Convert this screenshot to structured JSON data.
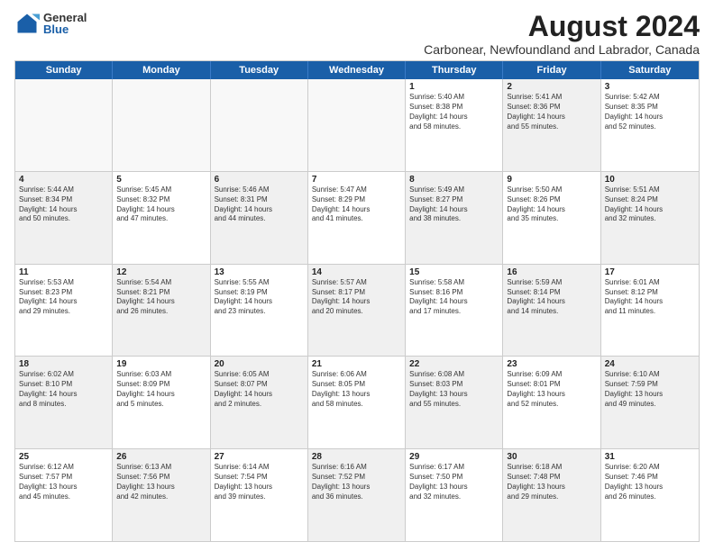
{
  "logo": {
    "general": "General",
    "blue": "Blue"
  },
  "title": "August 2024",
  "subtitle": "Carbonear, Newfoundland and Labrador, Canada",
  "dayHeaders": [
    "Sunday",
    "Monday",
    "Tuesday",
    "Wednesday",
    "Thursday",
    "Friday",
    "Saturday"
  ],
  "rows": [
    [
      {
        "day": "",
        "info": "",
        "empty": true
      },
      {
        "day": "",
        "info": "",
        "empty": true
      },
      {
        "day": "",
        "info": "",
        "empty": true
      },
      {
        "day": "",
        "info": "",
        "empty": true
      },
      {
        "day": "1",
        "info": "Sunrise: 5:40 AM\nSunset: 8:38 PM\nDaylight: 14 hours\nand 58 minutes.",
        "shaded": false
      },
      {
        "day": "2",
        "info": "Sunrise: 5:41 AM\nSunset: 8:36 PM\nDaylight: 14 hours\nand 55 minutes.",
        "shaded": true
      },
      {
        "day": "3",
        "info": "Sunrise: 5:42 AM\nSunset: 8:35 PM\nDaylight: 14 hours\nand 52 minutes.",
        "shaded": false
      }
    ],
    [
      {
        "day": "4",
        "info": "Sunrise: 5:44 AM\nSunset: 8:34 PM\nDaylight: 14 hours\nand 50 minutes.",
        "shaded": true
      },
      {
        "day": "5",
        "info": "Sunrise: 5:45 AM\nSunset: 8:32 PM\nDaylight: 14 hours\nand 47 minutes.",
        "shaded": false
      },
      {
        "day": "6",
        "info": "Sunrise: 5:46 AM\nSunset: 8:31 PM\nDaylight: 14 hours\nand 44 minutes.",
        "shaded": true
      },
      {
        "day": "7",
        "info": "Sunrise: 5:47 AM\nSunset: 8:29 PM\nDaylight: 14 hours\nand 41 minutes.",
        "shaded": false
      },
      {
        "day": "8",
        "info": "Sunrise: 5:49 AM\nSunset: 8:27 PM\nDaylight: 14 hours\nand 38 minutes.",
        "shaded": true
      },
      {
        "day": "9",
        "info": "Sunrise: 5:50 AM\nSunset: 8:26 PM\nDaylight: 14 hours\nand 35 minutes.",
        "shaded": false
      },
      {
        "day": "10",
        "info": "Sunrise: 5:51 AM\nSunset: 8:24 PM\nDaylight: 14 hours\nand 32 minutes.",
        "shaded": true
      }
    ],
    [
      {
        "day": "11",
        "info": "Sunrise: 5:53 AM\nSunset: 8:23 PM\nDaylight: 14 hours\nand 29 minutes.",
        "shaded": false
      },
      {
        "day": "12",
        "info": "Sunrise: 5:54 AM\nSunset: 8:21 PM\nDaylight: 14 hours\nand 26 minutes.",
        "shaded": true
      },
      {
        "day": "13",
        "info": "Sunrise: 5:55 AM\nSunset: 8:19 PM\nDaylight: 14 hours\nand 23 minutes.",
        "shaded": false
      },
      {
        "day": "14",
        "info": "Sunrise: 5:57 AM\nSunset: 8:17 PM\nDaylight: 14 hours\nand 20 minutes.",
        "shaded": true
      },
      {
        "day": "15",
        "info": "Sunrise: 5:58 AM\nSunset: 8:16 PM\nDaylight: 14 hours\nand 17 minutes.",
        "shaded": false
      },
      {
        "day": "16",
        "info": "Sunrise: 5:59 AM\nSunset: 8:14 PM\nDaylight: 14 hours\nand 14 minutes.",
        "shaded": true
      },
      {
        "day": "17",
        "info": "Sunrise: 6:01 AM\nSunset: 8:12 PM\nDaylight: 14 hours\nand 11 minutes.",
        "shaded": false
      }
    ],
    [
      {
        "day": "18",
        "info": "Sunrise: 6:02 AM\nSunset: 8:10 PM\nDaylight: 14 hours\nand 8 minutes.",
        "shaded": true
      },
      {
        "day": "19",
        "info": "Sunrise: 6:03 AM\nSunset: 8:09 PM\nDaylight: 14 hours\nand 5 minutes.",
        "shaded": false
      },
      {
        "day": "20",
        "info": "Sunrise: 6:05 AM\nSunset: 8:07 PM\nDaylight: 14 hours\nand 2 minutes.",
        "shaded": true
      },
      {
        "day": "21",
        "info": "Sunrise: 6:06 AM\nSunset: 8:05 PM\nDaylight: 13 hours\nand 58 minutes.",
        "shaded": false
      },
      {
        "day": "22",
        "info": "Sunrise: 6:08 AM\nSunset: 8:03 PM\nDaylight: 13 hours\nand 55 minutes.",
        "shaded": true
      },
      {
        "day": "23",
        "info": "Sunrise: 6:09 AM\nSunset: 8:01 PM\nDaylight: 13 hours\nand 52 minutes.",
        "shaded": false
      },
      {
        "day": "24",
        "info": "Sunrise: 6:10 AM\nSunset: 7:59 PM\nDaylight: 13 hours\nand 49 minutes.",
        "shaded": true
      }
    ],
    [
      {
        "day": "25",
        "info": "Sunrise: 6:12 AM\nSunset: 7:57 PM\nDaylight: 13 hours\nand 45 minutes.",
        "shaded": false
      },
      {
        "day": "26",
        "info": "Sunrise: 6:13 AM\nSunset: 7:56 PM\nDaylight: 13 hours\nand 42 minutes.",
        "shaded": true
      },
      {
        "day": "27",
        "info": "Sunrise: 6:14 AM\nSunset: 7:54 PM\nDaylight: 13 hours\nand 39 minutes.",
        "shaded": false
      },
      {
        "day": "28",
        "info": "Sunrise: 6:16 AM\nSunset: 7:52 PM\nDaylight: 13 hours\nand 36 minutes.",
        "shaded": true
      },
      {
        "day": "29",
        "info": "Sunrise: 6:17 AM\nSunset: 7:50 PM\nDaylight: 13 hours\nand 32 minutes.",
        "shaded": false
      },
      {
        "day": "30",
        "info": "Sunrise: 6:18 AM\nSunset: 7:48 PM\nDaylight: 13 hours\nand 29 minutes.",
        "shaded": true
      },
      {
        "day": "31",
        "info": "Sunrise: 6:20 AM\nSunset: 7:46 PM\nDaylight: 13 hours\nand 26 minutes.",
        "shaded": false
      }
    ]
  ]
}
